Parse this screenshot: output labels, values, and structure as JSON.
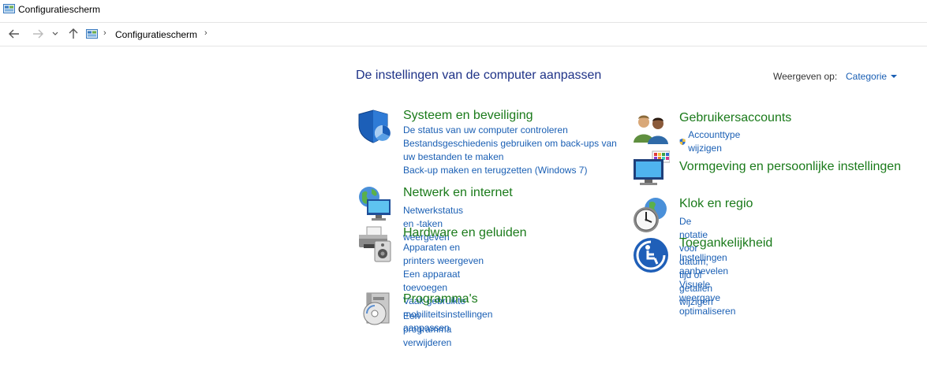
{
  "window": {
    "title": "Configuratiescherm"
  },
  "address": {
    "crumb": "Configuratiescherm"
  },
  "main": {
    "heading": "De instellingen van de computer aanpassen",
    "view": {
      "label": "Weergeven op:",
      "value": "Categorie"
    }
  },
  "categories": {
    "system": {
      "title": "Systeem en beveiliging",
      "links": [
        "De status van uw computer controleren",
        "Bestandsgeschiedenis gebruiken om back-ups van uw bestanden te maken",
        "Back-up maken en terugzetten (Windows 7)"
      ]
    },
    "network": {
      "title": "Netwerk en internet",
      "links": [
        "Netwerkstatus en -taken weergeven"
      ]
    },
    "hardware": {
      "title": "Hardware en geluiden",
      "links": [
        "Apparaten en printers weergeven",
        "Een apparaat toevoegen",
        "Vaak gebruikte mobiliteitsinstellingen aanpassen"
      ]
    },
    "programs": {
      "title": "Programma's",
      "links": [
        "Een programma verwijderen"
      ]
    },
    "users": {
      "title": "Gebruikersaccounts",
      "links": [
        "Accounttype wijzigen"
      ]
    },
    "appearance": {
      "title": "Vormgeving en persoonlijke instellingen"
    },
    "clock": {
      "title": "Klok en regio",
      "links": [
        "De notatie voor datum, tijd of getallen wijzigen"
      ]
    },
    "access": {
      "title": "Toegankelijkheid",
      "links": [
        "Instellingen aanbevelen",
        "Visuele weergave optimaliseren"
      ]
    }
  },
  "icons": {
    "window": "control-panel-icon",
    "back": "back-arrow-icon",
    "forward": "forward-arrow-icon",
    "recent": "chevron-down-icon",
    "up": "up-arrow-icon",
    "shield": "uac-shield-icon"
  },
  "colors": {
    "heading": "#1e3287",
    "category_title": "#1a7a1a",
    "link": "#1a5fb4"
  }
}
